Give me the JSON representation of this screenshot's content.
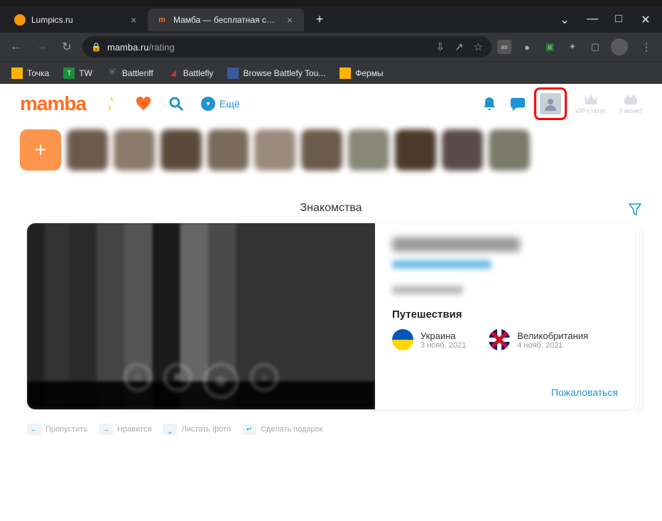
{
  "browser": {
    "tabs": [
      {
        "title": "Lumpics.ru",
        "active": false
      },
      {
        "title": "Мамба — бесплатная сеть знак",
        "active": true
      }
    ],
    "window": {
      "min": "—",
      "max": "□",
      "close": "✕",
      "dropdown": "⌄"
    },
    "nav": {
      "back": "←",
      "forward": "→",
      "reload": "↻"
    },
    "url": {
      "domain": "mamba.ru",
      "path": "/rating"
    },
    "addr_icons": {
      "install": "⇩",
      "share": "↗",
      "star": "☆"
    },
    "ext": {
      "lastfm": "as",
      "ext2": "●",
      "ext3": "▣",
      "puzzle": "✦",
      "window": "▢"
    },
    "menu": "⋮",
    "bookmarks": [
      {
        "label": "Точка",
        "color": "#ffb400"
      },
      {
        "label": "TW",
        "color": "#1a8f3a"
      },
      {
        "label": "Battleriff",
        "color": "#444"
      },
      {
        "label": "Battlefly",
        "color": "#c0392b"
      },
      {
        "label": "Browse Battlefy Tou...",
        "color": "#3a5a9a"
      },
      {
        "label": "Фермы",
        "color": "#ffb400"
      }
    ]
  },
  "header": {
    "logo": "mamba",
    "more": "Ещё",
    "vip": "VIP-статус",
    "coins": "0 монет"
  },
  "section_title": "Знакомства",
  "profile": {
    "travel_title": "Путешествия",
    "trips": [
      {
        "country": "Украина",
        "date": "3 нояб. 2021",
        "flag": "ua"
      },
      {
        "country": "Великобритания",
        "date": "4 нояб. 2021",
        "flag": "uk"
      }
    ],
    "complain": "Пожаловаться"
  },
  "actions": [
    {
      "key": "←",
      "label": "Пропустить"
    },
    {
      "key": "→",
      "label": "Нравится"
    },
    {
      "key": "⎵",
      "label": "Листать фото"
    },
    {
      "key": "↵",
      "label": "Сделать подарок"
    }
  ]
}
